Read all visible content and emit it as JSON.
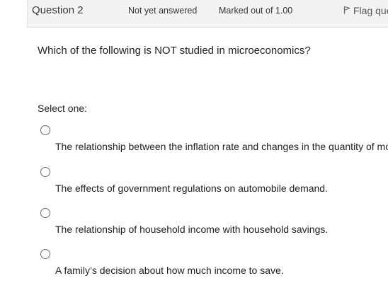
{
  "header": {
    "title": "Question 2",
    "status": "Not yet answered",
    "marks": "Marked out of 1.00",
    "flag_label": "Flag question",
    "flag_icon": "flag-icon"
  },
  "question": {
    "text": "Which of the following is NOT studied in microeconomics?",
    "prompt": "Select one:"
  },
  "options": [
    {
      "label": "The relationship between the inflation rate and changes in the quantity of money.",
      "selected": false
    },
    {
      "label": "The effects of government regulations on automobile demand.",
      "selected": false
    },
    {
      "label": "The relationship of household income with household savings.",
      "selected": false
    },
    {
      "label": "A family’s decision about how much income to save.",
      "selected": false
    }
  ]
}
